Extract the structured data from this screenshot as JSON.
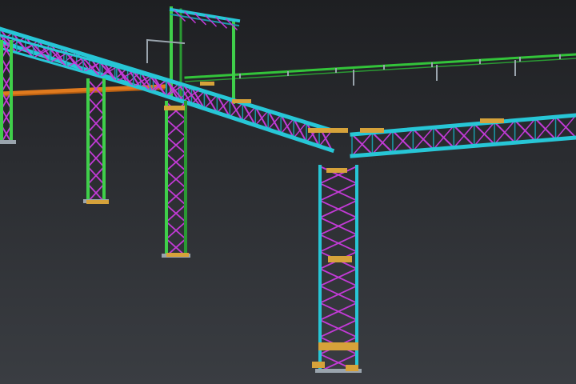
{
  "viewport": {
    "background_top": "#1e1f22",
    "background_bottom": "#3a3d42"
  },
  "palette": {
    "chord": "#27c6d6",
    "chord_dark": "#1a9aa8",
    "bracing": "#c23ad6",
    "column": "#3fcf4a",
    "column_dark": "#2a9a33",
    "gusset": "#d6a23a",
    "beam": "#e07a1e",
    "pipe_line": "#33c43a",
    "steel_grey": "#9aa4ad"
  },
  "model": {
    "elements": [
      "truss-bridge",
      "truss-column",
      "gusset-plate",
      "pipe-rack-line",
      "cross-beam",
      "portal-frame"
    ]
  }
}
